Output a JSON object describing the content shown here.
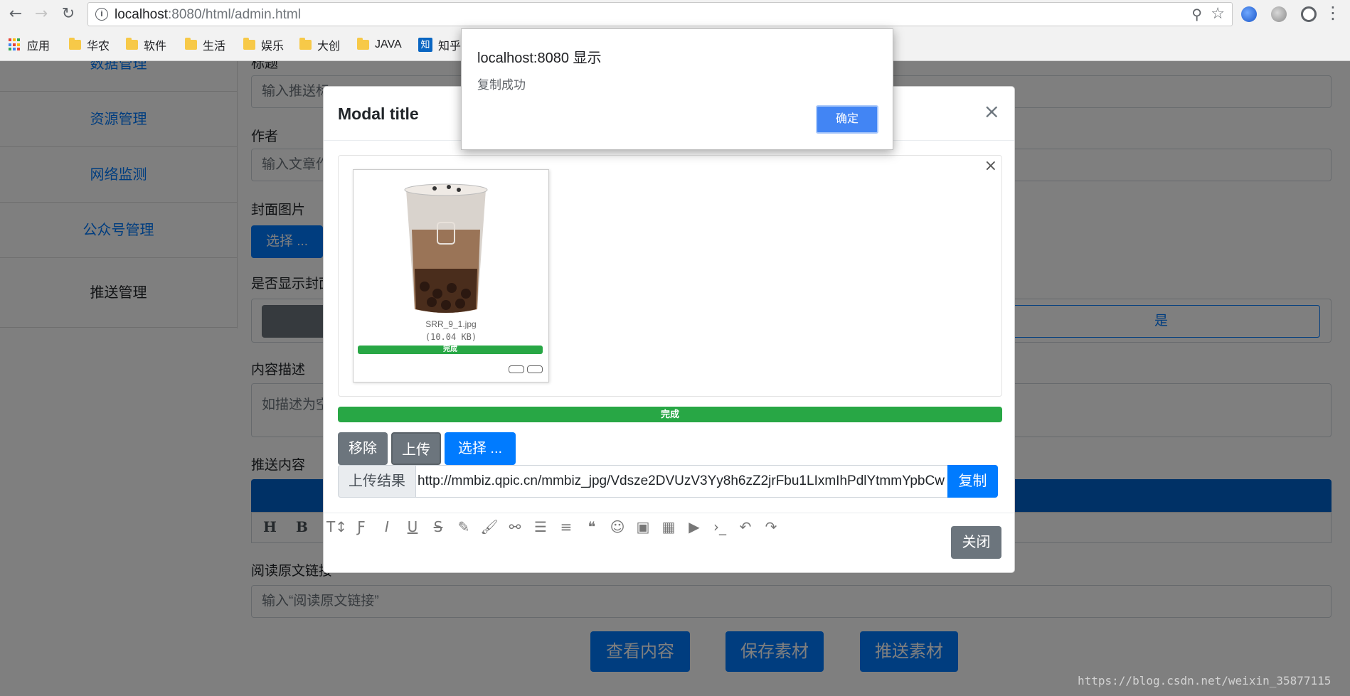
{
  "browser": {
    "url_host": "localhost",
    "url_rest": ":8080/html/admin.html",
    "bookmarks": [
      {
        "label": "应用",
        "icon": "apps-grid-icon"
      },
      {
        "label": "华农",
        "icon": "folder-icon"
      },
      {
        "label": "软件",
        "icon": "folder-icon"
      },
      {
        "label": "生活",
        "icon": "folder-icon"
      },
      {
        "label": "娱乐",
        "icon": "folder-icon"
      },
      {
        "label": "大创",
        "icon": "folder-icon"
      },
      {
        "label": "JAVA",
        "icon": "folder-icon"
      },
      {
        "label": "知乎",
        "icon": "zhihu-icon"
      }
    ]
  },
  "sidebar": {
    "items": [
      {
        "label": "数据管理"
      },
      {
        "label": "资源管理"
      },
      {
        "label": "网络监测"
      },
      {
        "label": "公众号管理"
      },
      {
        "label": "推送管理"
      }
    ]
  },
  "form": {
    "title_label": "标题",
    "title_placeholder": "输入推送标",
    "author_label": "作者",
    "author_placeholder": "输入文章作",
    "cover_label": "封面图片",
    "cover_button": "选择 ...",
    "show_cover_label": "是否显示封面",
    "yes_label": "是",
    "desc_label": "内容描述",
    "desc_placeholder": "如描述为空",
    "content_label": "推送内容",
    "editor_tools": [
      "H",
      "B"
    ],
    "read_more_label": "阅读原文链接",
    "read_more_placeholder": "输入“阅读原文链接”",
    "btn_view": "查看内容",
    "btn_save": "保存素材",
    "btn_push": "推送素材"
  },
  "modal": {
    "title": "Modal title",
    "file_name": "SRR_9_1.jpg",
    "file_size": "(10.04 KB)",
    "file_progress_label": "完成",
    "file_progress": 1.0,
    "total_progress_label": "完成",
    "total_progress": 1.0,
    "btn_remove": "移除",
    "btn_upload": "上传",
    "btn_select": "选择 ...",
    "result_prefix": "上传结果",
    "result_value": "http://mmbiz.qpic.cn/mmbiz_jpg/Vdsze2DVUzV3Yy8h6zZ2jrFbu1LIxmIhPdlYtmmYpbCw",
    "btn_copy": "复制",
    "btn_close": "关闭"
  },
  "alert": {
    "title": "localhost:8080 显示",
    "message": "复制成功",
    "ok": "确定"
  },
  "watermark": "https://blog.csdn.net/weixin_35877115",
  "colors": {
    "primary": "#007bff",
    "secondary": "#6c757d",
    "success": "#28a745",
    "chrome_blue": "#4285f4"
  }
}
